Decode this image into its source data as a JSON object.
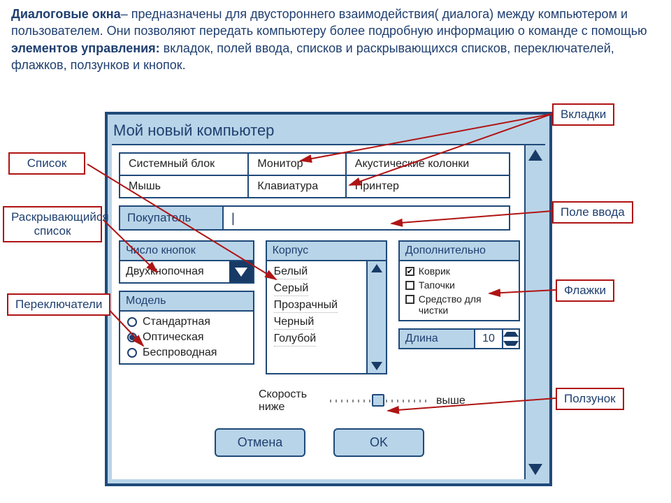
{
  "paragraph": {
    "lead_bold": "Диалоговые окна",
    "t1": "– предназначены для двустороннего взаимодействия( диалога) между компьютером и пользователем.  Они позволяют передать компьютеру более подробную информацию о команде с помощью ",
    "bold2": "элементов управления:",
    "t2": " вкладок, полей ввода, списков и раскрывающихся списков, переключателей, флажков, ползунков и кнопок."
  },
  "callouts": {
    "tabs": "Вкладки",
    "list": "Список",
    "dropdown": "Раскрывающийся список",
    "radios": "Переключатели",
    "input": "Поле ввода",
    "checks": "Флажки",
    "slider": "Ползунок"
  },
  "dialog": {
    "title": "Мой новый компьютер",
    "tabs_row1": [
      "Системный блок",
      "Монитор",
      "Акустические колонки"
    ],
    "tabs_row2": [
      "Мышь",
      "Клавиатура",
      "Принтер"
    ],
    "buyer_label": "Покупатель",
    "buyer_value": "|",
    "buttons_panel": {
      "title": "Число кнопок",
      "value": "Двухкнопочная"
    },
    "model_panel": {
      "title": "Модель",
      "options": [
        "Стандартная",
        "Оптическая",
        "Беспроводная"
      ],
      "selected_index": 1
    },
    "body_panel": {
      "title": "Корпус",
      "items": [
        "Белый",
        "Серый",
        "Прозрачный",
        "Черный",
        "Голубой"
      ]
    },
    "extra_panel": {
      "title": "Дополнительно",
      "items": [
        {
          "label": "Коврик",
          "checked": true
        },
        {
          "label": "Тапочки",
          "checked": false
        },
        {
          "label": "Средство для чистки",
          "checked": false
        }
      ]
    },
    "length": {
      "label": "Длина",
      "value": "10"
    },
    "slider": {
      "title": "Скорость",
      "low": "ниже",
      "high": "выше"
    },
    "btn_cancel": "Отмена",
    "btn_ok": "OK"
  }
}
